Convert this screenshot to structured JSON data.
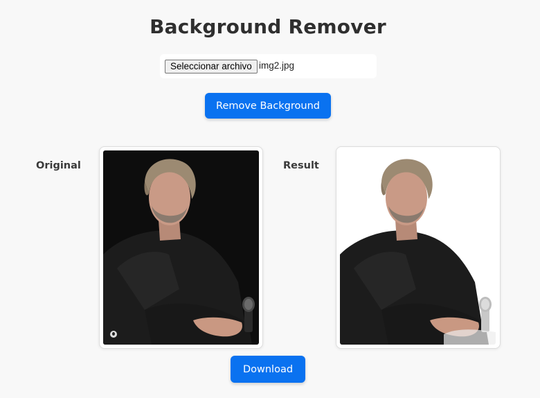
{
  "header": {
    "title": "Background Remover"
  },
  "file_input": {
    "button_label": "Seleccionar archivo",
    "file_name": "img2.jpg"
  },
  "actions": {
    "remove_label": "Remove Background",
    "download_label": "Download"
  },
  "panels": {
    "original_label": "Original",
    "result_label": "Result"
  },
  "colors": {
    "accent": "#0a72f0",
    "page_background": "#f8f8f8",
    "original_photo_background": "#111111",
    "result_photo_background": "#ffffff"
  }
}
